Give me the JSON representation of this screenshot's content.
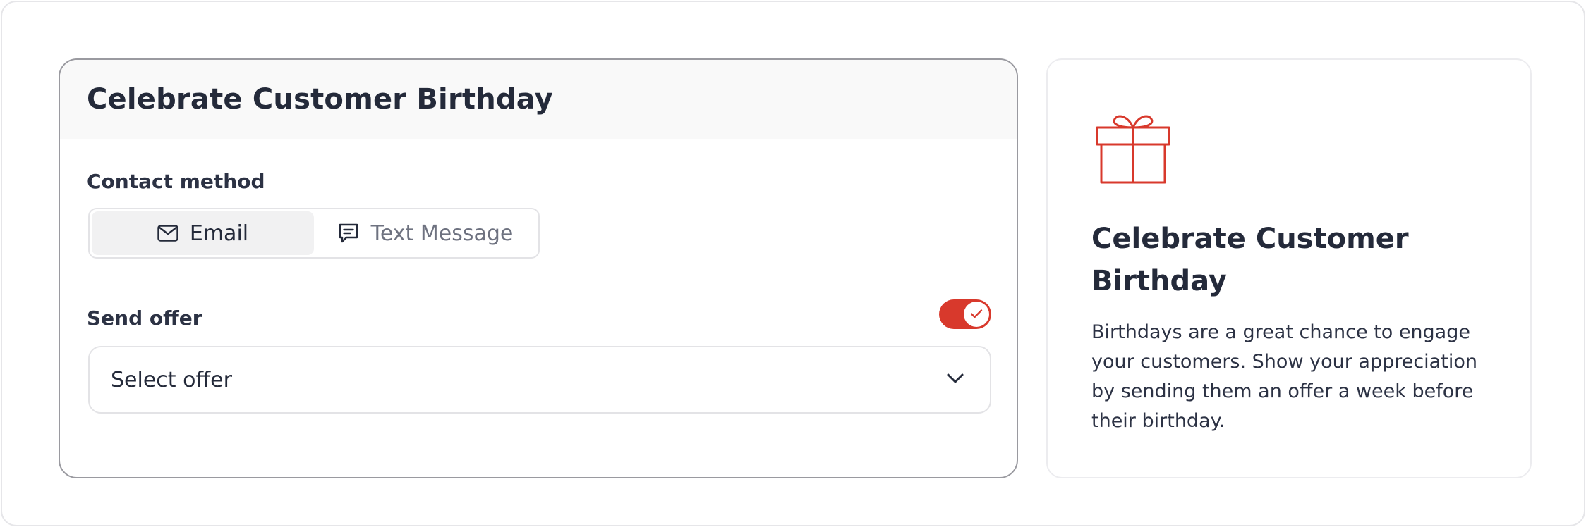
{
  "form": {
    "title": "Celebrate Customer Birthday",
    "contact_method_label": "Contact method",
    "contact_options": [
      {
        "label": "Email",
        "icon": "mail-icon",
        "selected": true
      },
      {
        "label": "Text Message",
        "icon": "chat-icon",
        "selected": false
      }
    ],
    "send_offer_label": "Send offer",
    "send_offer_enabled": true,
    "offer_select": {
      "value": "Select offer"
    }
  },
  "info": {
    "icon": "gift-icon",
    "title": "Celebrate Customer Birthday",
    "description": "Birthdays are a great chance to engage your customers. Show your appreciation by sending them an offer a week before their birthday."
  },
  "colors": {
    "accent": "#d8392c",
    "text": "#242a3a",
    "muted": "#6e7280"
  }
}
